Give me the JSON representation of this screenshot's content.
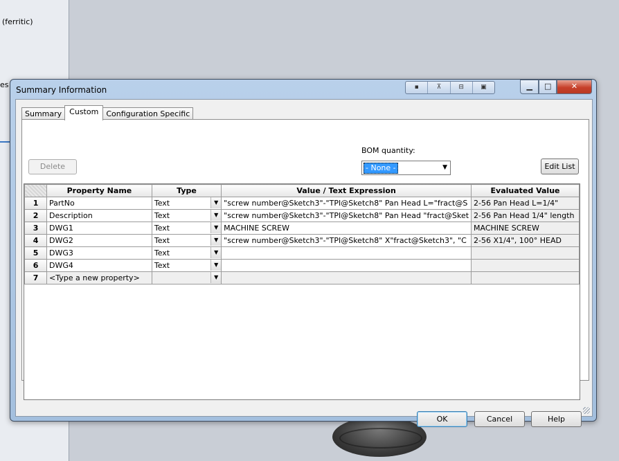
{
  "background": {
    "left_text_1": "(ferritic)",
    "left_text_2": "es"
  },
  "dialog": {
    "title": "Summary Information",
    "tabs": [
      {
        "label": "Summary"
      },
      {
        "label": "Custom"
      },
      {
        "label": "Configuration Specific"
      }
    ],
    "delete_label": "Delete",
    "bom_label": "BOM quantity:",
    "bom_value": "- None -",
    "edit_list_label": "Edit List",
    "ok_label": "OK",
    "cancel_label": "Cancel",
    "help_label": "Help",
    "accent": "#3399ff",
    "close_color": "#c7402a"
  },
  "grid": {
    "headers": [
      "",
      "Property Name",
      "Type",
      "Value / Text Expression",
      "Evaluated Value"
    ],
    "rows": [
      {
        "num": "1",
        "name": "PartNo",
        "type": "Text",
        "value": "\"screw number@Sketch3\"-\"TPI@Sketch8\" Pan Head L=\"fract@S",
        "evaluated": "2-56 Pan Head L=1/4\""
      },
      {
        "num": "2",
        "name": "Description",
        "type": "Text",
        "value": "\"screw number@Sketch3\"-\"TPI@Sketch8\" Pan Head \"fract@Sket",
        "evaluated": "2-56 Pan Head 1/4\" length"
      },
      {
        "num": "3",
        "name": "DWG1",
        "type": "Text",
        "value": "MACHINE SCREW",
        "evaluated": "MACHINE SCREW"
      },
      {
        "num": "4",
        "name": "DWG2",
        "type": "Text",
        "value": "\"screw number@Sketch3\"-\"TPI@Sketch8\" X\"fract@Sketch3\", \"C",
        "evaluated": "2-56 X1/4\", 100° HEAD"
      },
      {
        "num": "5",
        "name": "DWG3",
        "type": "Text",
        "value": "",
        "evaluated": ""
      },
      {
        "num": "6",
        "name": "DWG4",
        "type": "Text",
        "value": "",
        "evaluated": ""
      },
      {
        "num": "7",
        "name": "<Type a new property>",
        "type": "",
        "value": "",
        "evaluated": ""
      }
    ]
  }
}
